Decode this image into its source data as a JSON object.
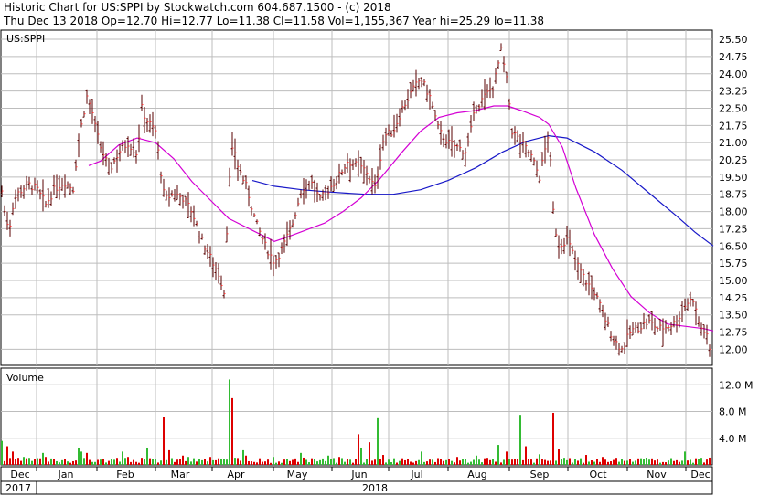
{
  "header": {
    "line1": "Historic Chart for US:SPPI by Stockwatch.com 604.687.1500 - (c) 2018",
    "line2": "Thu Dec 13 2018   Op=12.70  Hi=12.77  Lo=11.38  Cl=11.58  Vol=1,155,367  Year hi=25.29  lo=11.38"
  },
  "colors": {
    "price_bar": "#5a0000",
    "ma_short": "#d400d4",
    "ma_long": "#1818c8",
    "vol_up": "#33bb33",
    "vol_down": "#dd0000",
    "grid": "#bdbdbd"
  },
  "chart_data": [
    {
      "type": "ohlc",
      "title": "US:SPPI",
      "x_labels": [
        "Dec",
        "Jan",
        "Feb",
        "Mar",
        "Apr",
        "May",
        "Jun",
        "Jul",
        "Aug",
        "Sep",
        "Oct",
        "Nov",
        "Dec"
      ],
      "year_labels": [
        "2017",
        "2018"
      ],
      "y_ticks": [
        12.0,
        12.75,
        13.5,
        14.25,
        15.0,
        15.75,
        16.5,
        17.25,
        18.0,
        18.75,
        19.5,
        20.25,
        21.0,
        21.75,
        22.5,
        23.25,
        24.0,
        24.75,
        25.5
      ],
      "y_tick_labels": [
        "12.00",
        "12.75",
        "13.50",
        "14.25",
        "15.00",
        "15.75",
        "16.50",
        "17.25",
        "18.00",
        "18.75",
        "19.50",
        "20.25",
        "21.00",
        "21.75",
        "22.50",
        "23.25",
        "24.00",
        "24.75",
        "25.50"
      ],
      "ylim": [
        11.3,
        25.9
      ],
      "grid": true,
      "series": [
        {
          "kind": "price"
        },
        {
          "kind": "moving_average_short"
        },
        {
          "kind": "moving_average_long"
        }
      ],
      "price_close": [
        [
          0,
          19.5
        ],
        [
          5,
          18.0
        ],
        [
          10,
          17.2
        ],
        [
          15,
          18.5
        ],
        [
          20,
          18.8
        ],
        [
          30,
          19.2
        ],
        [
          40,
          19.0
        ],
        [
          50,
          18.3
        ],
        [
          60,
          19.0
        ],
        [
          70,
          19.3
        ],
        [
          80,
          19.0
        ],
        [
          85,
          20.8
        ],
        [
          90,
          22.0
        ],
        [
          95,
          23.0
        ],
        [
          100,
          22.5
        ],
        [
          105,
          21.5
        ],
        [
          110,
          20.8
        ],
        [
          120,
          19.8
        ],
        [
          130,
          20.6
        ],
        [
          140,
          21.0
        ],
        [
          150,
          20.5
        ],
        [
          155,
          22.5
        ],
        [
          160,
          22.0
        ],
        [
          170,
          21.5
        ],
        [
          180,
          18.5
        ],
        [
          190,
          18.8
        ],
        [
          200,
          18.6
        ],
        [
          210,
          18.0
        ],
        [
          220,
          16.8
        ],
        [
          230,
          16.0
        ],
        [
          240,
          15.2
        ],
        [
          245,
          14.5
        ],
        [
          250,
          19.0
        ],
        [
          255,
          21.0
        ],
        [
          260,
          20.0
        ],
        [
          270,
          19.0
        ],
        [
          280,
          17.5
        ],
        [
          290,
          16.5
        ],
        [
          300,
          15.8
        ],
        [
          310,
          16.5
        ],
        [
          320,
          17.5
        ],
        [
          330,
          19.0
        ],
        [
          340,
          19.3
        ],
        [
          350,
          18.5
        ],
        [
          360,
          19.0
        ],
        [
          370,
          19.5
        ],
        [
          380,
          20.2
        ],
        [
          390,
          20.0
        ],
        [
          400,
          19.8
        ],
        [
          410,
          19.0
        ],
        [
          420,
          21.3
        ],
        [
          430,
          21.5
        ],
        [
          440,
          22.5
        ],
        [
          450,
          23.2
        ],
        [
          460,
          23.8
        ],
        [
          470,
          23.0
        ],
        [
          480,
          21.5
        ],
        [
          490,
          21.0
        ],
        [
          500,
          20.8
        ],
        [
          510,
          20.6
        ],
        [
          520,
          22.5
        ],
        [
          530,
          23.0
        ],
        [
          540,
          23.5
        ],
        [
          548,
          25.0
        ],
        [
          555,
          23.5
        ],
        [
          560,
          21.5
        ],
        [
          570,
          21.0
        ],
        [
          580,
          20.5
        ],
        [
          590,
          19.5
        ],
        [
          600,
          21.5
        ],
        [
          605,
          18.0
        ],
        [
          610,
          16.5
        ],
        [
          620,
          16.8
        ],
        [
          630,
          15.8
        ],
        [
          640,
          15.0
        ],
        [
          650,
          14.5
        ],
        [
          660,
          13.5
        ],
        [
          670,
          12.5
        ],
        [
          680,
          12.0
        ],
        [
          690,
          12.8
        ],
        [
          700,
          13.0
        ],
        [
          710,
          13.2
        ],
        [
          720,
          12.9
        ],
        [
          730,
          13.0
        ],
        [
          740,
          13.2
        ],
        [
          750,
          14.0
        ],
        [
          758,
          14.2
        ],
        [
          765,
          13.0
        ],
        [
          772,
          12.7
        ],
        [
          778,
          11.6
        ]
      ],
      "ma_short": [
        [
          97,
          20.0
        ],
        [
          110,
          20.2
        ],
        [
          130,
          20.9
        ],
        [
          150,
          21.2
        ],
        [
          170,
          21.0
        ],
        [
          190,
          20.3
        ],
        [
          210,
          19.3
        ],
        [
          230,
          18.5
        ],
        [
          250,
          17.7
        ],
        [
          270,
          17.3
        ],
        [
          290,
          16.9
        ],
        [
          300,
          16.7
        ],
        [
          315,
          16.9
        ],
        [
          335,
          17.2
        ],
        [
          355,
          17.5
        ],
        [
          375,
          18.0
        ],
        [
          395,
          18.6
        ],
        [
          415,
          19.4
        ],
        [
          440,
          20.6
        ],
        [
          460,
          21.5
        ],
        [
          480,
          22.1
        ],
        [
          500,
          22.3
        ],
        [
          520,
          22.4
        ],
        [
          540,
          22.6
        ],
        [
          555,
          22.6
        ],
        [
          570,
          22.4
        ],
        [
          590,
          22.1
        ],
        [
          600,
          21.8
        ],
        [
          615,
          20.8
        ],
        [
          630,
          19.0
        ],
        [
          650,
          17.0
        ],
        [
          670,
          15.5
        ],
        [
          690,
          14.3
        ],
        [
          710,
          13.6
        ],
        [
          730,
          13.1
        ],
        [
          750,
          13.0
        ],
        [
          770,
          12.9
        ],
        [
          780,
          12.8
        ]
      ],
      "ma_long": [
        [
          276,
          19.35
        ],
        [
          300,
          19.1
        ],
        [
          330,
          18.95
        ],
        [
          360,
          18.85
        ],
        [
          380,
          18.8
        ],
        [
          400,
          18.75
        ],
        [
          430,
          18.75
        ],
        [
          460,
          18.95
        ],
        [
          490,
          19.35
        ],
        [
          520,
          19.9
        ],
        [
          550,
          20.6
        ],
        [
          575,
          21.05
        ],
        [
          600,
          21.3
        ],
        [
          620,
          21.2
        ],
        [
          650,
          20.6
        ],
        [
          680,
          19.8
        ],
        [
          710,
          18.8
        ],
        [
          740,
          17.8
        ],
        [
          760,
          17.1
        ],
        [
          780,
          16.5
        ]
      ]
    },
    {
      "type": "bar",
      "title": "Volume",
      "y_ticks": [
        4.0,
        8.0,
        12.0
      ],
      "y_tick_labels": [
        "4.0 M",
        "8.0 M",
        "12.0 M"
      ],
      "ylim": [
        0,
        14.5
      ],
      "unit": "M",
      "values_up": [
        [
          3,
          3.6
        ],
        [
          25,
          1.2
        ],
        [
          48,
          1.8
        ],
        [
          85,
          2.6
        ],
        [
          90,
          2.0
        ],
        [
          110,
          0.8
        ],
        [
          133,
          2.0
        ],
        [
          160,
          2.6
        ],
        [
          205,
          1.2
        ],
        [
          220,
          0.7
        ],
        [
          250,
          12.8
        ],
        [
          265,
          2.2
        ],
        [
          300,
          1.2
        ],
        [
          330,
          1.8
        ],
        [
          360,
          1.4
        ],
        [
          395,
          2.6
        ],
        [
          412,
          7.0
        ],
        [
          430,
          1.0
        ],
        [
          460,
          2.0
        ],
        [
          520,
          1.4
        ],
        [
          545,
          3.0
        ],
        [
          568,
          7.5
        ],
        [
          590,
          1.6
        ],
        [
          620,
          0.7
        ],
        [
          680,
          0.9
        ],
        [
          700,
          1.0
        ],
        [
          750,
          2.0
        ]
      ],
      "values_down": [
        [
          8,
          2.8
        ],
        [
          14,
          2.0
        ],
        [
          30,
          1.0
        ],
        [
          50,
          1.2
        ],
        [
          70,
          0.9
        ],
        [
          95,
          1.8
        ],
        [
          120,
          0.6
        ],
        [
          140,
          1.2
        ],
        [
          178,
          7.2
        ],
        [
          185,
          2.2
        ],
        [
          200,
          1.4
        ],
        [
          230,
          1.2
        ],
        [
          240,
          1.0
        ],
        [
          255,
          10.0
        ],
        [
          270,
          1.4
        ],
        [
          285,
          1.0
        ],
        [
          310,
          0.8
        ],
        [
          340,
          1.0
        ],
        [
          370,
          1.2
        ],
        [
          392,
          4.6
        ],
        [
          405,
          3.4
        ],
        [
          420,
          1.5
        ],
        [
          440,
          1.0
        ],
        [
          470,
          0.8
        ],
        [
          490,
          0.9
        ],
        [
          500,
          1.2
        ],
        [
          530,
          1.0
        ],
        [
          555,
          2.0
        ],
        [
          575,
          2.8
        ],
        [
          604,
          7.8
        ],
        [
          612,
          2.4
        ],
        [
          640,
          1.5
        ],
        [
          660,
          1.2
        ],
        [
          690,
          0.9
        ],
        [
          720,
          0.8
        ],
        [
          740,
          0.7
        ],
        [
          760,
          1.0
        ],
        [
          776,
          1.1
        ]
      ]
    }
  ]
}
